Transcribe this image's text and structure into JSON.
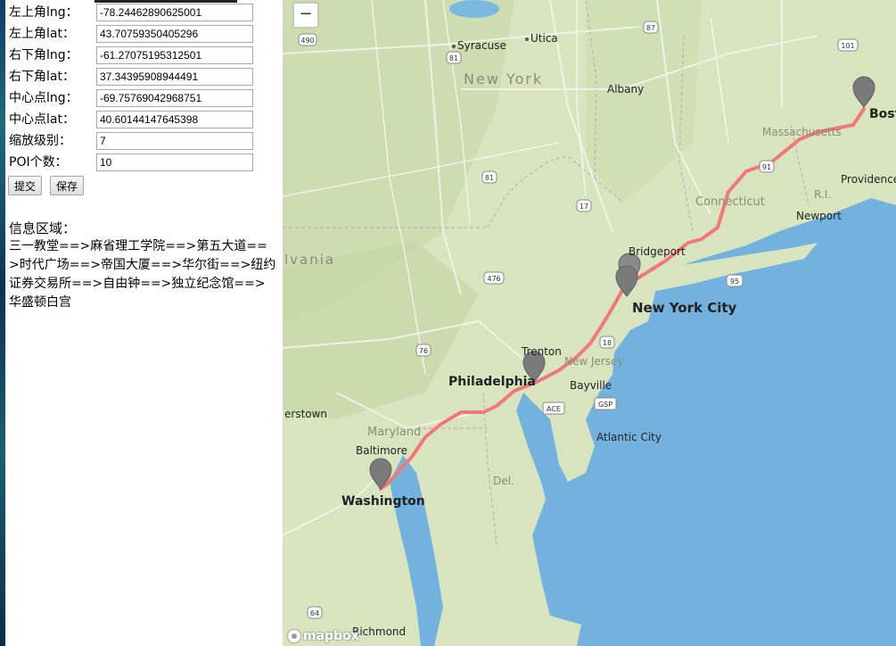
{
  "form": {
    "fields": [
      {
        "label": "左上角lng：",
        "value": "-78.24462890625001"
      },
      {
        "label": "左上角lat：",
        "value": "43.70759350405296"
      },
      {
        "label": "右下角lng：",
        "value": "-61.27075195312501"
      },
      {
        "label": "右下角lat：",
        "value": "37.34395908944491"
      },
      {
        "label": "中心点lng：",
        "value": "-69.75769042968751"
      },
      {
        "label": "中心点lat：",
        "value": "40.60144147645398"
      },
      {
        "label": "缩放级别：",
        "value": "7"
      },
      {
        "label": "POI个数：",
        "value": "10"
      }
    ],
    "submit_label": "提交",
    "save_label": "保存"
  },
  "info": {
    "title": "信息区域：",
    "route_text": "三一教堂==>麻省理工学院==>第五大道==>时代广场==>帝国大厦==>华尔街==>纽约证券交易所==>自由钟==>独立纪念馆==>华盛顿白宫"
  },
  "map": {
    "zoom_out_label": "−",
    "attribution": "mapbox",
    "colors": {
      "land": "#d6e3bc",
      "water": "#7bb8e0",
      "route": "#f2777a",
      "marker": "#7a7a7a"
    },
    "labels": {
      "states": [
        "New York",
        "Massachusetts",
        "Connecticut",
        "New Jersey",
        "Maryland",
        "Del.",
        "R.I.",
        "lvania"
      ],
      "cities": [
        "Syracuse",
        "Utica",
        "Albany",
        "Boston",
        "Providence",
        "Newport",
        "Bridgeport",
        "New York City",
        "Philadelphia",
        "Trenton",
        "Bayville",
        "Atlantic City",
        "Baltimore",
        "Washington",
        "Richmond",
        "erstown"
      ],
      "shields": [
        "490",
        "81",
        "87",
        "101",
        "91",
        "95",
        "81",
        "17",
        "476",
        "495",
        "76",
        "18",
        "ACE",
        "GSP",
        "64"
      ]
    }
  }
}
